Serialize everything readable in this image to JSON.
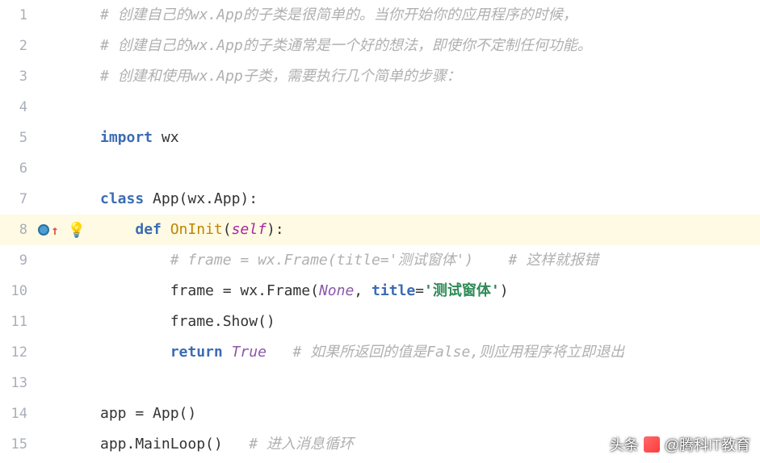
{
  "lines": [
    {
      "n": "1",
      "indent": 0,
      "tokens": [
        {
          "cls": "tok-comment",
          "t": "# 创建自己的wx.App的子类是很简单的。当你开始你的应用程序的时候，"
        }
      ]
    },
    {
      "n": "2",
      "indent": 0,
      "tokens": [
        {
          "cls": "tok-comment",
          "t": "# 创建自己的wx.App的子类通常是一个好的想法，即使你不定制任何功能。"
        }
      ]
    },
    {
      "n": "3",
      "indent": 0,
      "tokens": [
        {
          "cls": "tok-comment",
          "t": "# 创建和使用wx.App子类，需要执行几个简单的步骤："
        }
      ]
    },
    {
      "n": "4",
      "indent": 0,
      "tokens": []
    },
    {
      "n": "5",
      "indent": 0,
      "tokens": [
        {
          "cls": "tok-keyword",
          "t": "import"
        },
        {
          "cls": "tok-plain",
          "t": " wx"
        }
      ]
    },
    {
      "n": "6",
      "indent": 0,
      "tokens": []
    },
    {
      "n": "7",
      "indent": 0,
      "fold": true,
      "tokens": [
        {
          "cls": "tok-keyword",
          "t": "class"
        },
        {
          "cls": "tok-plain",
          "t": " "
        },
        {
          "cls": "tok-classname",
          "t": "App"
        },
        {
          "cls": "tok-plain",
          "t": "(wx.App):"
        }
      ]
    },
    {
      "n": "8",
      "indent": 1,
      "highlighted": true,
      "breakpoint": true,
      "bulb": true,
      "fold": true,
      "tokens": [
        {
          "cls": "tok-keyword",
          "t": "def"
        },
        {
          "cls": "tok-plain",
          "t": " "
        },
        {
          "cls": "tok-funcname",
          "t": "OnInit"
        },
        {
          "cls": "tok-plain",
          "t": "("
        },
        {
          "cls": "tok-special",
          "t": "self"
        },
        {
          "cls": "tok-plain",
          "t": "):"
        }
      ]
    },
    {
      "n": "9",
      "indent": 2,
      "tokens": [
        {
          "cls": "tok-comment",
          "t": "# frame = wx.Frame(title='测试窗体')    # 这样就报错"
        }
      ]
    },
    {
      "n": "10",
      "indent": 2,
      "tokens": [
        {
          "cls": "tok-plain",
          "t": "frame = wx.Frame("
        },
        {
          "cls": "tok-builtin",
          "t": "None"
        },
        {
          "cls": "tok-plain",
          "t": ", "
        },
        {
          "cls": "tok-param",
          "t": "title"
        },
        {
          "cls": "tok-plain",
          "t": "="
        },
        {
          "cls": "tok-string",
          "t": "'测试窗体'"
        },
        {
          "cls": "tok-plain",
          "t": ")"
        }
      ]
    },
    {
      "n": "11",
      "indent": 2,
      "tokens": [
        {
          "cls": "tok-plain",
          "t": "frame.Show()"
        }
      ]
    },
    {
      "n": "12",
      "indent": 2,
      "tokens": [
        {
          "cls": "tok-keyword",
          "t": "return"
        },
        {
          "cls": "tok-plain",
          "t": " "
        },
        {
          "cls": "tok-builtin",
          "t": "True"
        },
        {
          "cls": "tok-plain",
          "t": "   "
        },
        {
          "cls": "tok-comment",
          "t": "# 如果所返回的值是False,则应用程序将立即退出"
        }
      ]
    },
    {
      "n": "13",
      "indent": 0,
      "tokens": []
    },
    {
      "n": "14",
      "indent": 0,
      "tokens": [
        {
          "cls": "tok-plain",
          "t": "app = App()"
        }
      ]
    },
    {
      "n": "15",
      "indent": 0,
      "tokens": [
        {
          "cls": "tok-plain",
          "t": "app.MainLoop()   "
        },
        {
          "cls": "tok-comment",
          "t": "# 进入消息循环"
        }
      ]
    }
  ],
  "indent_unit": "    ",
  "watermark": {
    "prefix": "头条",
    "handle": "@腾科IT教育"
  }
}
